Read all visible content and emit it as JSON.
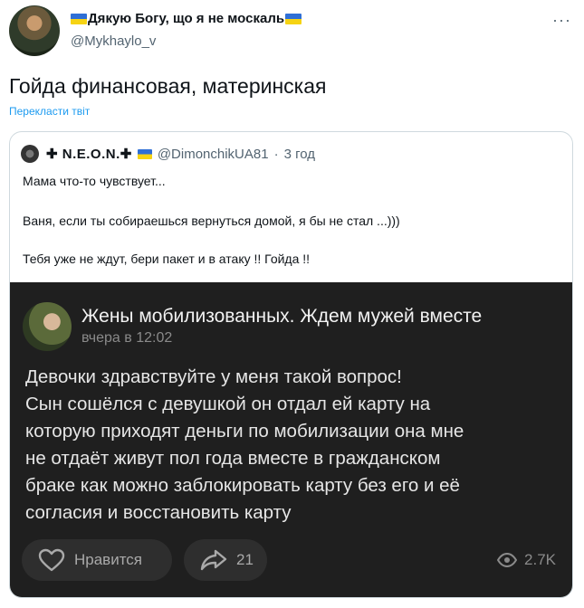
{
  "author": {
    "display_name": "Дякую Богу, що я не москаль",
    "handle": "@Mykhaylo_v",
    "more_label": "···"
  },
  "tweet": {
    "text": "Гойда финансовая, материнская",
    "translate_label": "Перекласти твіт"
  },
  "quote": {
    "name": "✚ N.E.O.N.✚",
    "handle": "@DimonchikUA81",
    "separator": "·",
    "time": "3 год",
    "lines": [
      "Мама что-то чувствует...",
      "Ваня, если ты собираешься вернуться домой, я бы не стал ...)))",
      "Тебя уже не ждут, бери пакет и в атаку !! Гойда !!"
    ]
  },
  "card": {
    "title": "Жены мобилизованных. Ждем мужей вместе",
    "time": "вчера в 12:02",
    "body_lines": [
      "Девочки здравствуйте у меня такой вопрос!",
      "Сын сошёлся с девушкой он отдал ей карту на",
      "которую приходят деньги по мобилизации она мне",
      "не отдаёт живут пол года вместе в гражданском",
      "браке как можно заблокировать карту без его и её",
      "согласия и восстановить карту"
    ],
    "like_label": "Нравится",
    "share_count": "21",
    "views": "2.7K"
  },
  "icons": {
    "flag": "ukraine-flag-icon",
    "like": "heart-icon",
    "share": "share-arrow-icon",
    "views": "eye-icon"
  },
  "colors": {
    "link": "#1d9bf0",
    "muted": "#536471",
    "card_bg": "#1f1f1f"
  }
}
